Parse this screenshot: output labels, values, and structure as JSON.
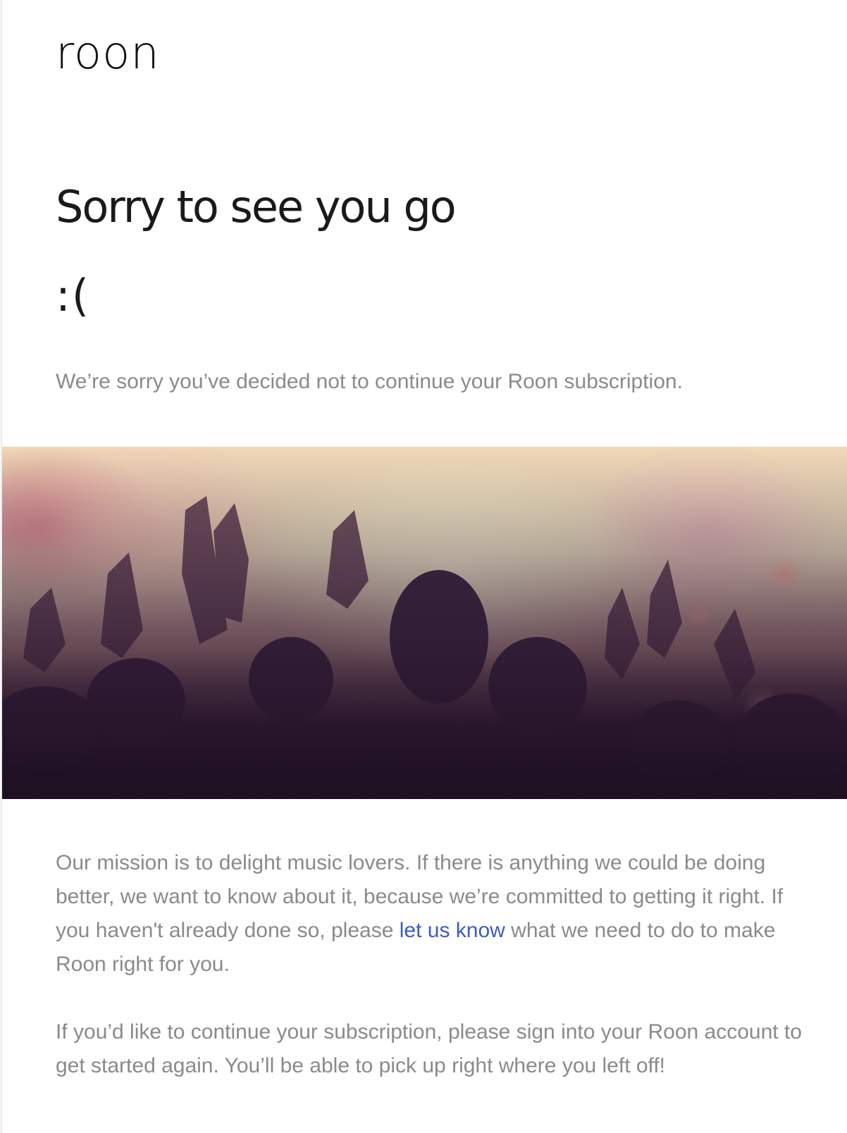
{
  "brand": {
    "logo_text": "roon"
  },
  "header": {
    "headline": "Sorry to see you go",
    "emoticon": ":("
  },
  "intro": {
    "text": "We’re sorry you’ve decided not to continue your Roon subscription."
  },
  "hero_image": {
    "description_icon": "concert-crowd-photo"
  },
  "body": {
    "paragraph1": {
      "before_link": "Our mission is to delight music lovers. If there is anything we could be doing better, we want to know about it, because we’re committed to getting it right. If you haven't already done so, please ",
      "link_text": "let us know",
      "after_link": " what we need to do to make Roon right for you."
    },
    "paragraph2": {
      "text": "If you’d like to continue your subscription, please sign into your Roon account to get started again. You’ll be able to pick up right where you left off!"
    }
  },
  "colors": {
    "body_text": "#8a8a8a",
    "link": "#3b5bc9",
    "heading": "#1a1a1a"
  }
}
